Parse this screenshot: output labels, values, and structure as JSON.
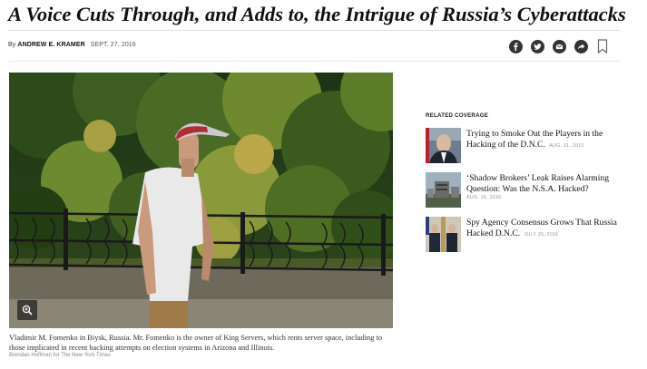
{
  "article": {
    "headline": "A Voice Cuts Through, and Adds to, the Intrigue of Russia’s Cyberattacks",
    "byline_prefix": "By ",
    "author": "ANDREW E. KRAMER",
    "date": "SEPT. 27, 2016"
  },
  "share": {
    "icons": [
      "facebook-icon",
      "twitter-icon",
      "email-icon",
      "share-arrow-icon",
      "bookmark-icon"
    ],
    "icon_bg": "#333333"
  },
  "photo": {
    "caption": "Vladimir M. Fomenko in Biysk, Russia. Mr. Fomenko is the owner of King Servers, which rents server space, including to those implicated in recent hacking attempts on election systems in Arizona and Illinois.",
    "credit": "Brendan Hoffman for The New York Times",
    "zoom_icon": "magnify-plus-icon"
  },
  "related": {
    "heading": "RELATED COVERAGE",
    "items": [
      {
        "title": "Trying to Smoke Out the Players in the Hacking of the D.N.C.",
        "title_a": "Trying to Smoke Out the Players in the",
        "title_b": "Hacking of the D.N.C.",
        "date": "AUG. 31, 2016"
      },
      {
        "title": "‘Shadow Brokers’ Leak Raises Alarming Question: Was the N.S.A. Hacked?",
        "title_a": "‘Shadow Brokers’ Leak Raises Alarming",
        "title_b": "Question: Was the N.S.A. Hacked?",
        "date": "AUG. 16, 2016"
      },
      {
        "title": "Spy Agency Consensus Grows That Russia Hacked D.N.C.",
        "title_a": "Spy Agency Consensus Grows That Russia",
        "title_b": "Hacked D.N.C.",
        "date": "JULY 26, 2016"
      }
    ]
  }
}
